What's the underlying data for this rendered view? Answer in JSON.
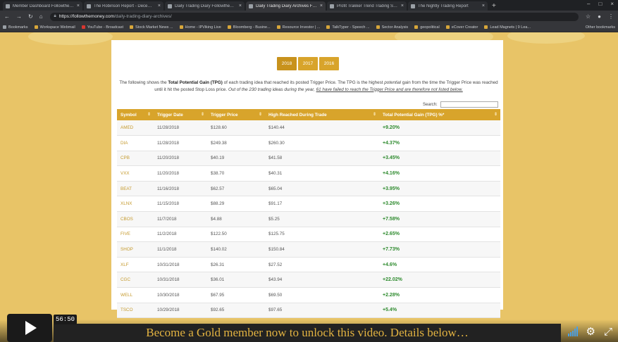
{
  "browser": {
    "tabs": [
      {
        "label": "Member Dashboard Followthemo..."
      },
      {
        "label": "The Robinson Report - Decembe..."
      },
      {
        "label": "Daily Trading Diary Followthemo..."
      },
      {
        "label": "Daily Trading Diary Archives Folk...",
        "active": true
      },
      {
        "label": "Profit Trakker Trend Trading Soft..."
      },
      {
        "label": "The Nightly Trading Report"
      }
    ],
    "url_host": "https://followthemoney.com",
    "url_path": "/daily-trading-diary-archives/",
    "bookmarks": [
      {
        "label": "Bookmarks",
        "icon": "star-icon"
      },
      {
        "label": "Workspace Webmail",
        "icon": "folder-icon"
      },
      {
        "label": "YouTube - Broadcast",
        "icon": "youtube-icon"
      },
      {
        "label": "Stock Market News ...",
        "icon": "page-icon"
      },
      {
        "label": "Home - IPViking Live",
        "icon": "page-icon"
      },
      {
        "label": "Bloomberg - Busine...",
        "icon": "page-icon"
      },
      {
        "label": "Resource Investor | ...",
        "icon": "page-icon"
      },
      {
        "label": "TalkTyper - Speech ...",
        "icon": "page-icon"
      },
      {
        "label": "Sector Analysis",
        "icon": "page-icon"
      },
      {
        "label": "geopolitical",
        "icon": "folder-icon"
      },
      {
        "label": "eCover Creator",
        "icon": "page-icon"
      },
      {
        "label": "Lead Magnets | 9 Lea...",
        "icon": "page-icon"
      }
    ],
    "other_bookmarks": "Other bookmarks"
  },
  "page": {
    "years": [
      "2018",
      "2017",
      "2016"
    ],
    "intro_a": "The following shows the ",
    "intro_b": "Total Potential Gain (TPG)",
    "intro_c": " of each trading idea that reached its posted Trigger Price. The TPG is the highest ",
    "intro_d": "potential",
    "intro_e": " gain from the time the Trigger Price was reached until it hit the posted Stop Loss price. ",
    "intro_f": "Out of the 230 trading ideas during the year, ",
    "intro_g": "61 have failed to reach the Trigger Price and are therefore not listed below.",
    "search_label": "Search:",
    "columns": [
      "Symbol",
      "Trigger Date",
      "Trigger Price",
      "High Reached During Trade",
      "Total Potential Gain (TPG) %*"
    ],
    "rows": [
      [
        "AMED",
        "11/28/2018",
        "$128.60",
        "$140.44",
        "+9.20%"
      ],
      [
        "DIA",
        "11/28/2018",
        "$249.38",
        "$260.30",
        "+4.37%"
      ],
      [
        "CPB",
        "11/20/2018",
        "$40.19",
        "$41.58",
        "+3.45%"
      ],
      [
        "VXX",
        "11/20/2018",
        "$38.70",
        "$40.31",
        "+4.16%"
      ],
      [
        "BEAT",
        "11/16/2018",
        "$62.57",
        "$65.04",
        "+3.95%"
      ],
      [
        "XLNX",
        "11/15/2018",
        "$88.29",
        "$91.17",
        "+3.26%"
      ],
      [
        "CBOS",
        "11/7/2018",
        "$4.88",
        "$5.25",
        "+7.58%"
      ],
      [
        "FIVE",
        "11/2/2018",
        "$122.50",
        "$125.75",
        "+2.65%"
      ],
      [
        "SHOP",
        "11/1/2018",
        "$140.02",
        "$150.84",
        "+7.73%"
      ],
      [
        "XLF",
        "10/31/2018",
        "$26.31",
        "$27.52",
        "+4.6%"
      ],
      [
        "CGC",
        "10/31/2018",
        "$36.01",
        "$43.94",
        "+22.02%"
      ],
      [
        "WELL",
        "10/30/2018",
        "$67.95",
        "$69.50",
        "+2.28%"
      ],
      [
        "TSCO",
        "10/29/2018",
        "$92.65",
        "$97.65",
        "+5.4%"
      ]
    ]
  },
  "video": {
    "time": "56:50",
    "promo": "Become a Gold member now to unlock this video. Details below…",
    "accent": "#e3b341"
  }
}
